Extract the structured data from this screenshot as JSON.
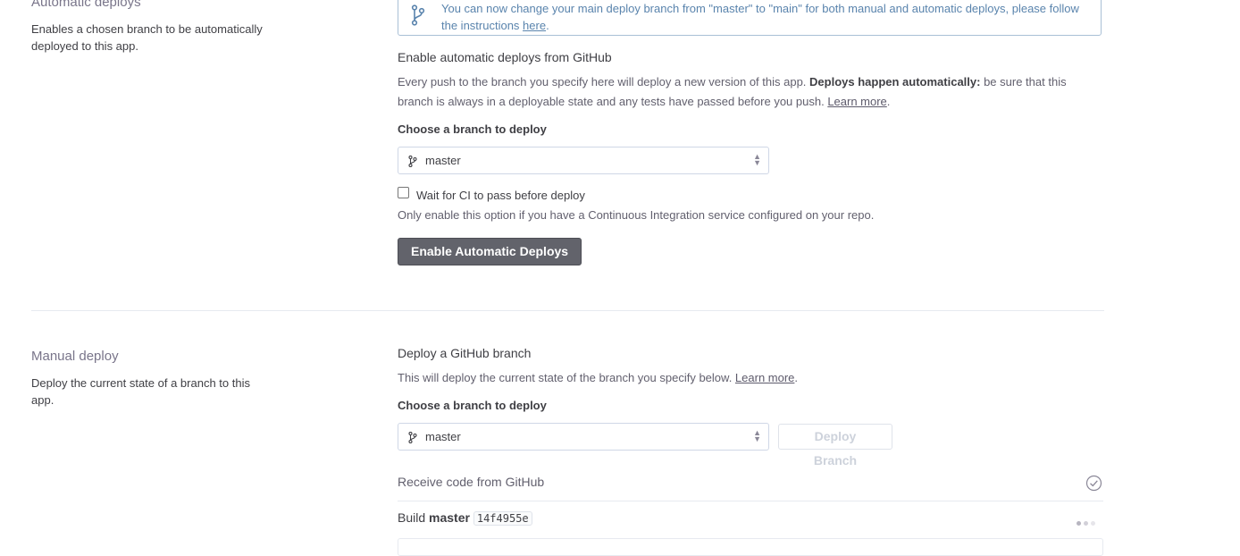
{
  "auto": {
    "section_title": "Automatic deploys",
    "section_desc": "Enables a chosen branch to be automatically deployed to this app.",
    "notice": {
      "text": "You can now change your main deploy branch from \"master\" to \"main\" for both manual and automatic deploys, please follow the instructions ",
      "link": "here",
      "end": "."
    },
    "heading": "Enable automatic deploys from GitHub",
    "desc_1": "Every push to the branch you specify here will deploy a new version of this app. ",
    "desc_bold": "Deploys happen automatically:",
    "desc_2": " be sure that this branch is always in a deployable state and any tests have passed before you push. ",
    "learn_more": "Learn more",
    "desc_end": ".",
    "choose_label": "Choose a branch to deploy",
    "branch_value": "master",
    "ci_label": "Wait for CI to pass before deploy",
    "ci_checked": false,
    "ci_hint": "Only enable this option if you have a Continuous Integration service configured on your repo.",
    "enable_button": "Enable Automatic Deploys"
  },
  "manual": {
    "section_title": "Manual deploy",
    "section_desc": "Deploy the current state of a branch to this app.",
    "heading": "Deploy a GitHub branch",
    "desc": "This will deploy the current state of the branch you specify below. ",
    "learn_more": "Learn more",
    "desc_end": ".",
    "choose_label": "Choose a branch to deploy",
    "branch_value": "master",
    "deploy_button": "Deploy Branch",
    "steps": {
      "receive": "Receive code from GitHub",
      "build_prefix": "Build ",
      "build_branch": "master",
      "build_commit": "14f4955e"
    }
  },
  "icons": {
    "branch": "git-branch-icon",
    "select_arrows": "chevron-updown-icon",
    "done": "check-circle-icon",
    "loading": "loading-dots-icon"
  },
  "colors": {
    "notice_text": "#5a84ad",
    "notice_border": "#a9c0d6",
    "button_dark": "#62636b",
    "divider": "#e7eaf0"
  }
}
